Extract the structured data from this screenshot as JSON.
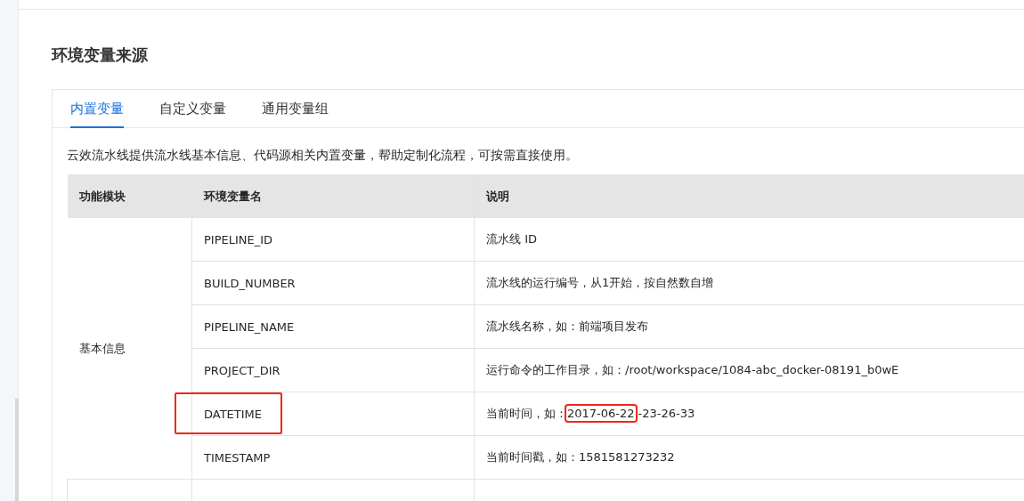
{
  "title": "环境变量来源",
  "tabs": [
    {
      "label": "内置变量",
      "selected": true
    },
    {
      "label": "自定义变量",
      "selected": false
    },
    {
      "label": "通用变量组",
      "selected": false
    }
  ],
  "intro": "云效流水线提供流水线基本信息、代码源相关内置变量，帮助定制化流程，可按需直接使用。",
  "table": {
    "columns": [
      "功能模块",
      "环境变量名",
      "说明"
    ],
    "groups": [
      {
        "module": "基本信息",
        "rows": [
          {
            "name": "PIPELINE_ID",
            "highlighted": false,
            "description": [
              {
                "text": "流水线 ID",
                "highlighted": false
              }
            ]
          },
          {
            "name": "BUILD_NUMBER",
            "highlighted": false,
            "description": [
              {
                "text": "流水线的运行编号，从1开始，按自然数自增",
                "highlighted": false
              }
            ]
          },
          {
            "name": "PIPELINE_NAME",
            "highlighted": false,
            "description": [
              {
                "text": "流水线名称，如：前端项目发布",
                "highlighted": false
              }
            ]
          },
          {
            "name": "PROJECT_DIR",
            "highlighted": false,
            "description": [
              {
                "text": "运行命令的工作目录，如：/root/workspace/1084-abc_docker-08191_b0wE",
                "highlighted": false
              }
            ]
          },
          {
            "name": "DATETIME",
            "highlighted": true,
            "description": [
              {
                "text": "当前时间，如：",
                "highlighted": false
              },
              {
                "text": "2017-06-22",
                "highlighted": true
              },
              {
                "text": "-23-26-33",
                "highlighted": false
              }
            ]
          },
          {
            "name": "TIMESTAMP",
            "highlighted": false,
            "description": [
              {
                "text": "当前时间戳，如：1581581273232",
                "highlighted": false
              }
            ]
          }
        ]
      }
    ]
  }
}
